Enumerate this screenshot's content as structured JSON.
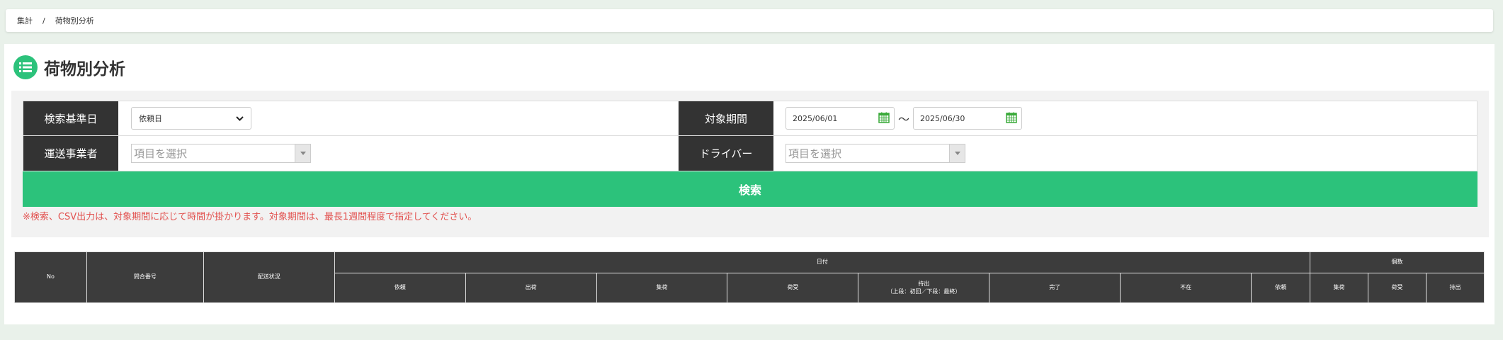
{
  "breadcrumb": {
    "items": [
      "集計",
      "荷物別分析"
    ],
    "separator": "/"
  },
  "page": {
    "title": "荷物別分析",
    "icon": "list-icon"
  },
  "form": {
    "base_date_label": "検索基準日",
    "base_date_value": "依頼日",
    "period_label": "対象期間",
    "period_from": "2025/06/01",
    "period_to": "2025/06/30",
    "period_separator": "〜",
    "carrier_label": "運送事業者",
    "carrier_placeholder": "項目を選択",
    "driver_label": "ドライバー",
    "driver_placeholder": "項目を選択",
    "search_label": "検索",
    "notice": "※検索、CSV出力は、対象期間に応じて時間が掛かります。対象期間は、最長1週間程度で指定してください。"
  },
  "table": {
    "col_no": "No",
    "col_inquiry": "問合番号",
    "col_status": "配送状況",
    "group_date": "日付",
    "group_count": "個数",
    "date_cols": [
      "依頼",
      "出荷",
      "集荷",
      "荷受",
      "持出",
      "完了",
      "不在",
      "依頼"
    ],
    "mochidashi_note": "（上段：初回／下段：最終）",
    "count_cols": [
      "集荷",
      "荷受",
      "持出"
    ]
  },
  "colors": {
    "accent": "#2cc27b",
    "header_dark": "#333333",
    "notice": "#e2514f",
    "background": "#e9f1ea"
  }
}
